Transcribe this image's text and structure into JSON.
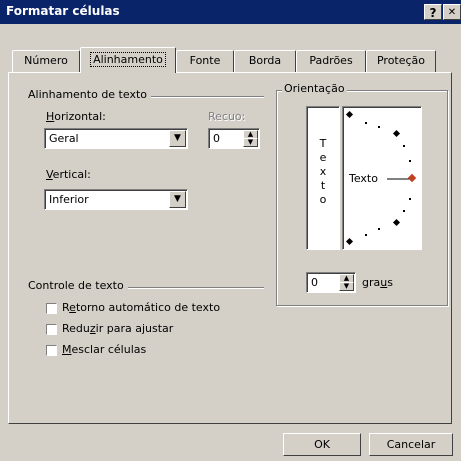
{
  "dialog": {
    "title": "Formatar células",
    "help_label": "?",
    "close_label": "✕"
  },
  "tabs": [
    {
      "label": "Número"
    },
    {
      "label": "Alinhamento"
    },
    {
      "label": "Fonte"
    },
    {
      "label": "Borda"
    },
    {
      "label": "Padrões"
    },
    {
      "label": "Proteção"
    }
  ],
  "alignment": {
    "group_label": "Alinhamento de texto",
    "horizontal_label_pre": "",
    "horizontal_label_u": "H",
    "horizontal_label_post": "orizontal:",
    "horizontal_value": "Geral",
    "indent_label": "Recuo:",
    "indent_value": "0",
    "vertical_label_u": "V",
    "vertical_label_post": "ertical:",
    "vertical_value": "Inferior"
  },
  "orientation": {
    "group_label": "Orientação",
    "vertical_text": [
      "T",
      "e",
      "x",
      "t",
      "o"
    ],
    "dial_text": "Texto",
    "degrees_value": "0",
    "degrees_label_pre": "gra",
    "degrees_label_u": "u",
    "degrees_label_post": "s"
  },
  "text_control": {
    "group_label": "Controle de texto",
    "wrap": {
      "pre": "R",
      "u": "e",
      "post": "torno automático de texto",
      "checked": false
    },
    "shrink": {
      "pre": "Redu",
      "u": "z",
      "post": "ir para ajustar",
      "checked": false
    },
    "merge": {
      "pre": "",
      "u": "M",
      "post": "esclar células",
      "checked": false
    }
  },
  "buttons": {
    "ok": "OK",
    "cancel": "Cancelar"
  }
}
